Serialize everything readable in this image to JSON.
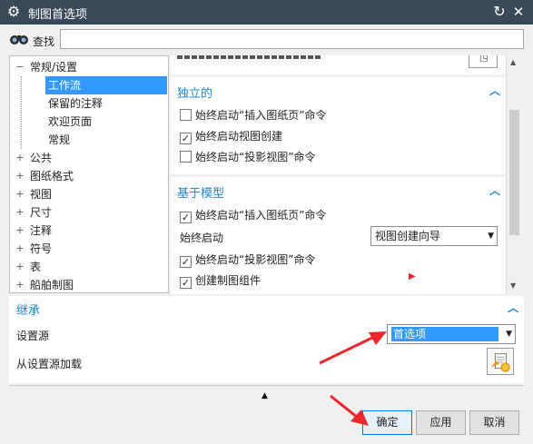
{
  "window": {
    "title": "制图首选项",
    "gear_icon": "gear-icon",
    "reset_icon": "reset-icon",
    "close_icon": "close-icon"
  },
  "find": {
    "label": "查找",
    "value": "",
    "placeholder": ""
  },
  "tree": {
    "items": [
      {
        "label": "常规/设置",
        "toggle": "−",
        "selected": false,
        "level": 0
      },
      {
        "label": "工作流",
        "toggle": "",
        "selected": true,
        "level": 1
      },
      {
        "label": "保留的注释",
        "toggle": "",
        "selected": false,
        "level": 1
      },
      {
        "label": "欢迎页面",
        "toggle": "",
        "selected": false,
        "level": 1
      },
      {
        "label": "常规",
        "toggle": "",
        "selected": false,
        "level": 1
      },
      {
        "label": "公共",
        "toggle": "+",
        "selected": false,
        "level": 0
      },
      {
        "label": "图纸格式",
        "toggle": "+",
        "selected": false,
        "level": 0
      },
      {
        "label": "视图",
        "toggle": "+",
        "selected": false,
        "level": 0
      },
      {
        "label": "尺寸",
        "toggle": "+",
        "selected": false,
        "level": 0
      },
      {
        "label": "注释",
        "toggle": "+",
        "selected": false,
        "level": 0
      },
      {
        "label": "符号",
        "toggle": "+",
        "selected": false,
        "level": 0
      },
      {
        "label": "表",
        "toggle": "+",
        "selected": false,
        "level": 0
      },
      {
        "label": "船舶制图",
        "toggle": "+",
        "selected": false,
        "level": 0
      }
    ]
  },
  "independent": {
    "title": "独立的",
    "options": [
      {
        "label": "始终启动“插入图纸页”命令",
        "checked": false
      },
      {
        "label": "始终启动视图创建",
        "checked": true
      },
      {
        "label": "始终启动“投影视图”命令",
        "checked": false
      }
    ]
  },
  "model_based": {
    "title": "基于模型",
    "insert_sheet": {
      "label": "始终启动“插入图纸页”命令",
      "checked": true
    },
    "always_start_label": "始终启动",
    "always_start_value": "视图创建向导",
    "projected_view": {
      "label": "始终启动“投影视图”命令",
      "checked": true
    },
    "create_component": {
      "label": "创建制图组件",
      "checked": true
    }
  },
  "inherit": {
    "title": "继承",
    "source_label": "设置源",
    "source_value": "首选项",
    "load_label": "从设置源加载",
    "load_icon": "load-settings-icon"
  },
  "buttons": {
    "ok": "确定",
    "apply": "应用",
    "cancel": "取消"
  },
  "colors": {
    "titlebar": "#38495a",
    "accent": "#1e87c8",
    "selection": "#3399ff",
    "arrow": "#e8262b"
  }
}
